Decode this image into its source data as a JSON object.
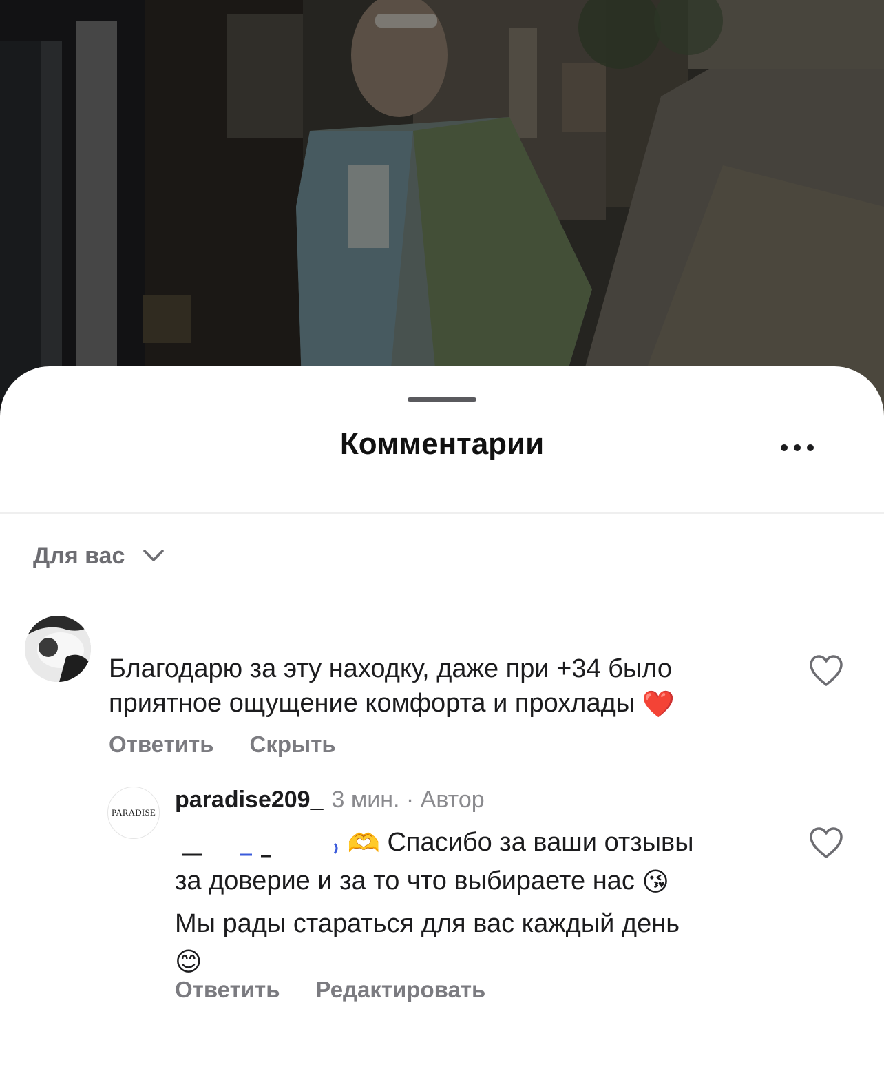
{
  "sheet": {
    "title": "Комментарии",
    "more_icon": "more-horizontal-icon"
  },
  "filter": {
    "label": "Для вас",
    "icon": "chevron-down-icon"
  },
  "comment": {
    "text": "Благодарю за эту находку, даже при +34 было приятное ощущение комфорта и прохлады",
    "emoji": "❤️",
    "reply_label": "Ответить",
    "hide_label": "Скрыть",
    "like_icon": "heart-outline-icon"
  },
  "reply": {
    "username": "paradise209_",
    "meta": "3 мин. · Автор",
    "avatar_text": "PARADISE",
    "emoji_hands": "🫶",
    "text_line1": "Спасибо за ваши отзывы",
    "text_line2": "за доверие  и за то что выбираете нас",
    "emoji_kiss": "😘",
    "text_line3": "Мы рады стараться для вас каждый день",
    "emoji_smile": "😊",
    "reply_label": "Ответить",
    "edit_label": "Редактировать",
    "like_icon": "heart-outline-icon"
  },
  "colors": {
    "text_primary": "#1c1c1e",
    "text_secondary": "#7b7b80",
    "sheet_bg": "#ffffff",
    "photo_overlay": "#000000"
  }
}
